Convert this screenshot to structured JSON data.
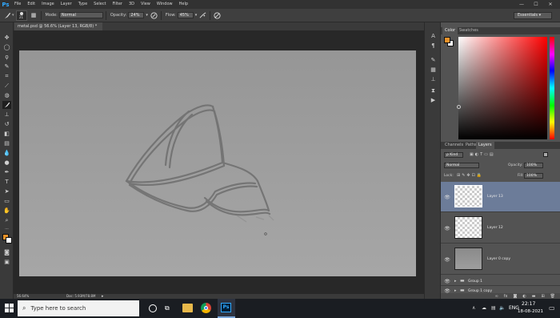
{
  "menubar": {
    "logo": "Ps",
    "items": [
      "File",
      "Edit",
      "Image",
      "Layer",
      "Type",
      "Select",
      "Filter",
      "3D",
      "View",
      "Window",
      "Help"
    ],
    "minimize": "—",
    "maximize": "☐",
    "close": "✕"
  },
  "options": {
    "brush_size": "21",
    "mode_label": "Mode:",
    "mode_value": "Normal",
    "opacity_label": "Opacity:",
    "opacity_value": "24%",
    "flow_label": "Flow:",
    "flow_value": "45%",
    "workspace": "Essentials"
  },
  "document": {
    "tab_title": "metal.psd @ 56.6% (Layer 13, RGB/8) *",
    "tab_close": "×",
    "zoom": "56.64%",
    "doc_size": "Doc: 5.93M/78.8M"
  },
  "panels": {
    "color_tabs": [
      "Color",
      "Swatches"
    ],
    "layer_tabs": [
      "Channels",
      "Paths",
      "Layers"
    ],
    "kind_label": "ρ Kind",
    "blend_mode": "Normal",
    "opacity_label": "Opacity:",
    "opacity_value": "100%",
    "lock_label": "Lock:",
    "fill_label": "Fill:",
    "fill_value": "100%",
    "layers": [
      {
        "name": "Layer 13",
        "selected": true
      },
      {
        "name": "Layer 12",
        "selected": false
      },
      {
        "name": "Layer 0 copy",
        "selected": false
      },
      {
        "name": "Group 1",
        "selected": false
      },
      {
        "name": "Group 1 copy",
        "selected": false
      }
    ]
  },
  "colors": {
    "foreground": "#e8922a",
    "background": "#ffffff",
    "accent": "#31a8ff",
    "selected_layer": "#6c7c99"
  },
  "taskbar": {
    "search_placeholder": "Type here to search",
    "language": "ENG",
    "time": "22:17",
    "date": "18-08-2021"
  }
}
